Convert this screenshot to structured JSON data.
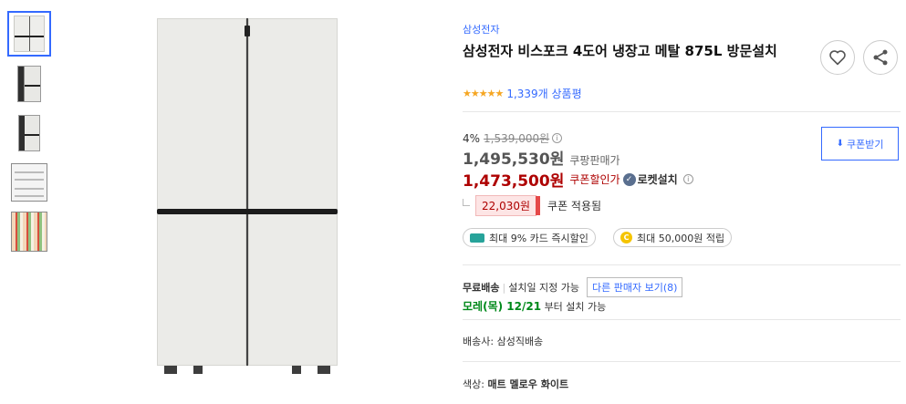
{
  "gallery": {
    "thumbnails": [
      {
        "alt": "closed-front",
        "active": true
      },
      {
        "alt": "angled",
        "active": false
      },
      {
        "alt": "angled-side",
        "active": false
      },
      {
        "alt": "open-empty",
        "active": false
      },
      {
        "alt": "open-filled",
        "active": false
      }
    ]
  },
  "product": {
    "brand": "삼성전자",
    "title": "삼성전자 비스포크 4도어 냉장고 메탈 875L 방문설치",
    "stars": "★★★★★",
    "review_count": "1,339개 상품평"
  },
  "pricing": {
    "discount_pct": "4%",
    "original_price": "1,539,000원",
    "info_glyph": "i",
    "sale_price": "1,495,530원",
    "sale_label": "쿠팡판매가",
    "coupon_price": "1,473,500원",
    "coupon_label": "쿠폰할인가",
    "rocket_label": "로켓설치",
    "coupon_button": "쿠폰받기",
    "coupon_amount": "22,030원",
    "coupon_applied": "쿠폰 적용됨"
  },
  "benefits": {
    "card": "최대 9% 카드 즉시할인",
    "points_coin": "C",
    "points": "최대 50,000원 적립"
  },
  "shipping": {
    "free": "무료배송",
    "install_date": "설치일 지정 가능",
    "other_sellers": "다른 판매자 보기(8)",
    "eta_date": "모레(목) 12/21",
    "eta_suffix": "부터 설치 가능",
    "carrier_label": "배송사:",
    "carrier": "삼성직배송"
  },
  "option": {
    "color_label": "색상:",
    "color_value": "매트 멜로우 화이트"
  },
  "colors": {
    "accent": "#346aff",
    "price_red": "#ae0000",
    "eta_green": "#00891a",
    "star": "#f5a623"
  }
}
